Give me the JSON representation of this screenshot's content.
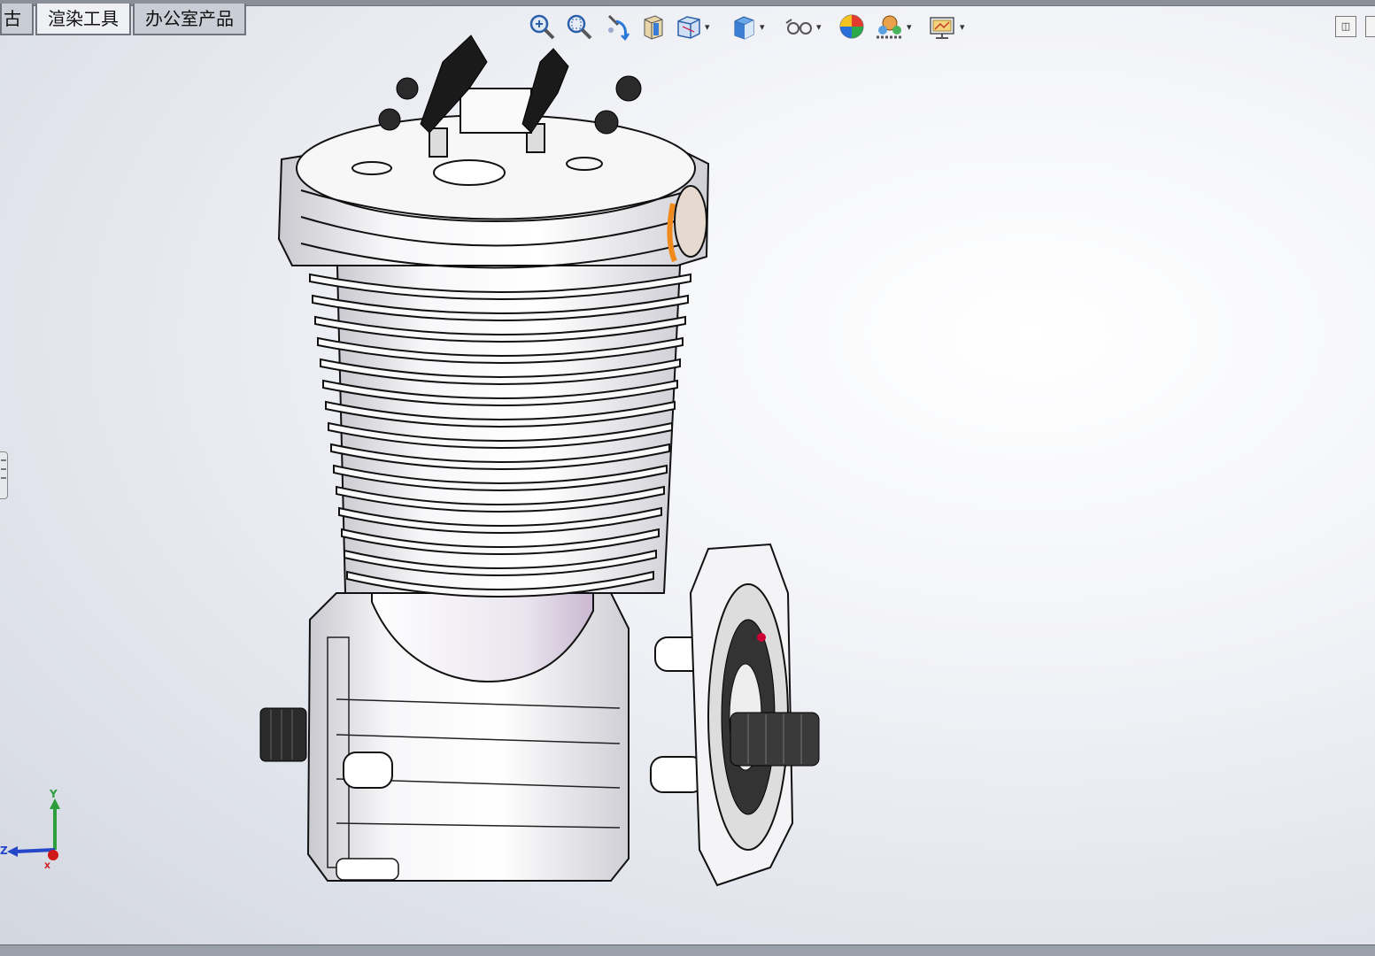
{
  "tabs": [
    {
      "label": "古",
      "active": false,
      "clipped": true
    },
    {
      "label": "渲染工具",
      "active": true
    },
    {
      "label": "办公室产品",
      "active": false
    }
  ],
  "toolbar": {
    "icons": [
      {
        "name": "zoom-to-fit-icon",
        "dropdown": false
      },
      {
        "name": "zoom-to-area-icon",
        "dropdown": false
      },
      {
        "name": "previous-view-icon",
        "dropdown": false
      },
      {
        "name": "section-view-icon",
        "dropdown": false
      },
      {
        "name": "view-orientation-icon",
        "dropdown": true
      },
      {
        "name": "display-style-icon",
        "dropdown": true
      },
      {
        "name": "hide-show-items-icon",
        "dropdown": true
      },
      {
        "name": "edit-appearance-icon",
        "dropdown": false
      },
      {
        "name": "apply-scene-icon",
        "dropdown": true
      },
      {
        "name": "view-settings-icon",
        "dropdown": true
      }
    ],
    "dropdown_glyph": "▾"
  },
  "window_controls": {
    "restore": "◫",
    "more": "⋯"
  },
  "triad": {
    "y": "Y",
    "z": "Z",
    "x": "X"
  },
  "colors": {
    "accent_orange": "#f08a1c",
    "axis_y": "#2e9e3a",
    "axis_z": "#2446c8",
    "axis_x": "#d01818"
  }
}
